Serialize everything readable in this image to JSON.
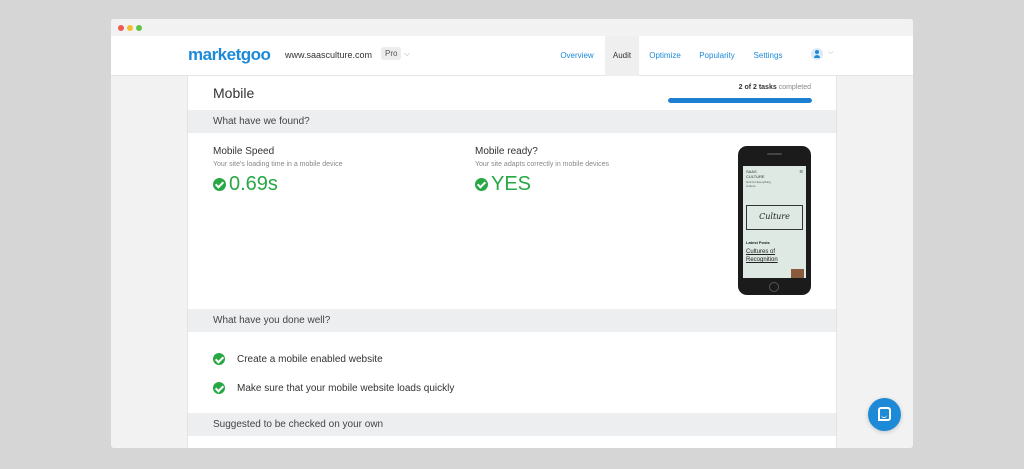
{
  "browser": {
    "dots": [
      "close",
      "minimize",
      "maximize"
    ]
  },
  "header": {
    "logo": "marketgoo",
    "site": "www.saasculture.com",
    "plan_badge": "Pro",
    "chevron": "⌵",
    "nav": [
      {
        "label": "Overview",
        "active": false
      },
      {
        "label": "Audit",
        "active": true
      },
      {
        "label": "Optimize",
        "active": false
      },
      {
        "label": "Popularity",
        "active": false
      },
      {
        "label": "Settings",
        "active": false
      }
    ],
    "user_chevron": "⌵"
  },
  "main": {
    "title": "Mobile",
    "tasks": {
      "count": "2 of 2 tasks",
      "suffix": "completed",
      "progress": 1.0
    },
    "found_header": "What have we found?",
    "metrics": [
      {
        "label": "Mobile Speed",
        "description": "Your site's loading time in a mobile device",
        "value": "0.69s"
      },
      {
        "label": "Mobile ready?",
        "description": "Your site adapts correctly in mobile devices",
        "value": "YES"
      }
    ],
    "phone_preview": {
      "site_name": "SAAS CULTURE",
      "tagline": "Hub for Everything Culture",
      "menu": "☰",
      "logo_text": "Culture",
      "latest_label": "Latest Posts",
      "post_title": "Cultures of Recognition"
    },
    "done_header": "What have you done well?",
    "done_items": [
      "Create a mobile enabled website",
      "Make sure that your mobile website loads quickly"
    ],
    "suggested_header": "Suggested to be checked on your own"
  },
  "colors": {
    "accent": "#1d8ad8",
    "success": "#27a845",
    "progress": "#1d7fd1"
  }
}
